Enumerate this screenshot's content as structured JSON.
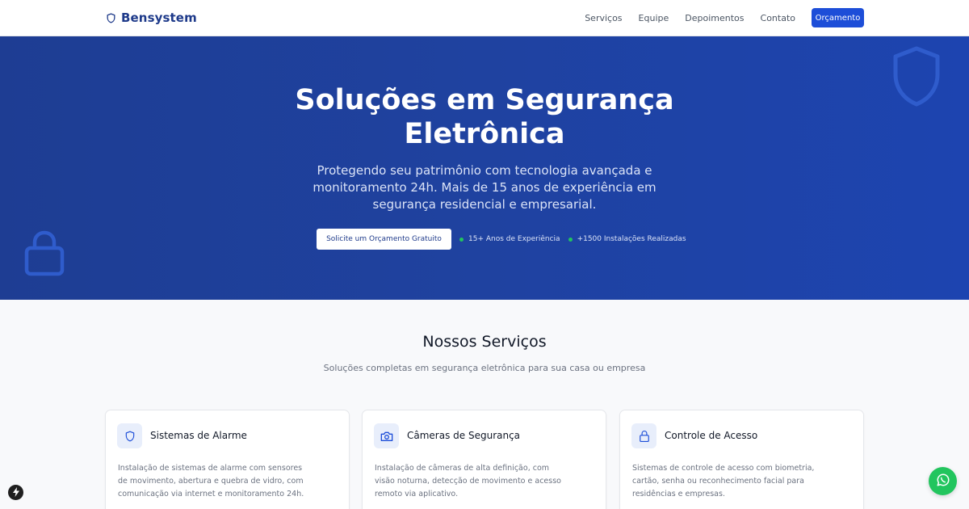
{
  "nav": {
    "brand": "Bensystem",
    "links": [
      "Serviços",
      "Equipe",
      "Depoimentos",
      "Contato"
    ],
    "cta": "Orçamento"
  },
  "hero": {
    "title_line1": "Soluções em Segurança",
    "title_line2": "Eletrônica",
    "subtitle": "Protegendo seu patrimônio com tecnologia avançada e monitoramento 24h. Mais de 15 anos de experiência em segurança residencial e empresarial.",
    "cta": "Solicite um Orçamento Gratuito",
    "stats": [
      "15+ Anos de Experiência",
      "+1500 Instalações Realizadas"
    ]
  },
  "services": {
    "title": "Nossos Serviços",
    "subtitle": "Soluções completas em segurança eletrônica para sua casa ou empresa",
    "cards": [
      {
        "title": "Sistemas de Alarme",
        "description": "Instalação de sistemas de alarme com sensores de movimento, abertura e quebra de vidro, com comunicação via internet e monitoramento 24h.",
        "icon": "shield-icon"
      },
      {
        "title": "Câmeras de Segurança",
        "description": "Instalação de câmeras de alta definição, com visão noturna, detecção de movimento e acesso remoto via aplicativo.",
        "icon": "camera-icon"
      },
      {
        "title": "Controle de Acesso",
        "description": "Sistemas de controle de acesso com biometria, cartão, senha ou reconhecimento facial para residências e empresas.",
        "icon": "lock-icon"
      }
    ]
  },
  "colors": {
    "primary": "#1d4ed8",
    "brand": "#1e3a8a",
    "hero_bg": "#1f42a0",
    "status_dot": "#22c55e",
    "whatsapp": "#22c55e"
  }
}
